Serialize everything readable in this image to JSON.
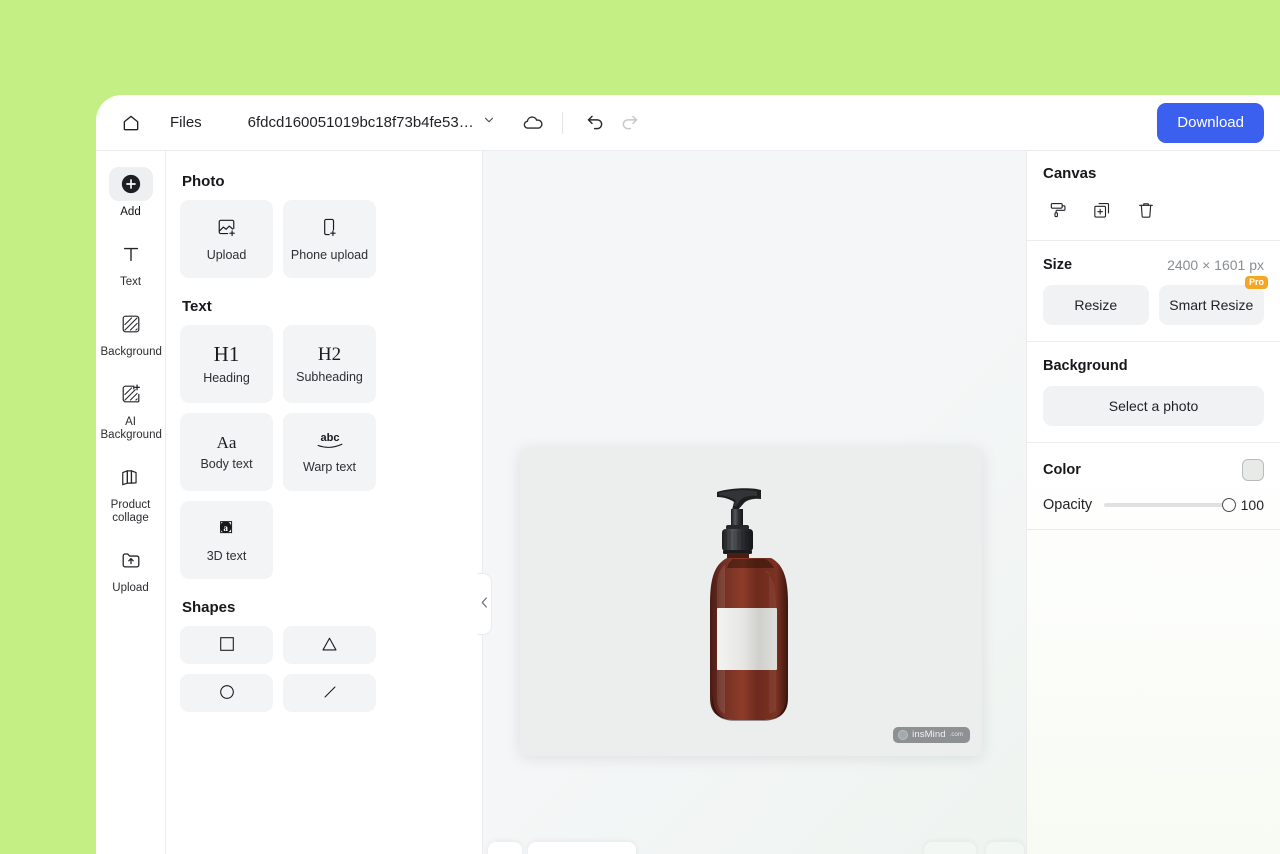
{
  "header": {
    "home_icon": "home-icon",
    "files_label": "Files",
    "document_name": "6fdcd160051019bc18f73b4fe53ae1...",
    "chevron_icon": "chevron-down-icon",
    "cloud_icon": "cloud-save-icon",
    "undo_icon": "undo-icon",
    "redo_icon": "redo-icon",
    "download_label": "Download"
  },
  "rail": {
    "items": [
      {
        "label": "Add",
        "icon": "plus-circle-icon",
        "active": true
      },
      {
        "label": "Text",
        "icon": "text-T-icon",
        "active": false
      },
      {
        "label": "Background",
        "icon": "hatch-square-icon",
        "active": false
      },
      {
        "label": "AI Background",
        "icon": "hatch-sparkle-icon",
        "active": false
      },
      {
        "label": "Product collage",
        "icon": "collage-icon",
        "active": false
      },
      {
        "label": "Upload",
        "icon": "folder-upload-icon",
        "active": false
      }
    ]
  },
  "panel": {
    "photo": {
      "title": "Photo",
      "items": [
        {
          "label": "Upload",
          "icon": "image-upload-icon"
        },
        {
          "label": "Phone upload",
          "icon": "phone-upload-icon"
        }
      ]
    },
    "text": {
      "title": "Text",
      "items": [
        {
          "label": "Heading",
          "glyph": "H1",
          "icon": "heading-icon"
        },
        {
          "label": "Subheading",
          "glyph": "H2",
          "icon": "subheading-icon"
        },
        {
          "label": "Body text",
          "glyph": "Aa",
          "icon": "body-text-icon"
        },
        {
          "label": "Warp text",
          "glyph": "abc",
          "icon": "warp-text-icon"
        },
        {
          "label": "3D text",
          "glyph": "a",
          "icon": "3d-text-icon"
        }
      ]
    },
    "shapes": {
      "title": "Shapes",
      "items": [
        {
          "label": "",
          "icon": "square-shape-icon"
        },
        {
          "label": "",
          "icon": "triangle-shape-icon"
        },
        {
          "label": "",
          "icon": "circle-shape-icon"
        },
        {
          "label": "",
          "icon": "line-shape-icon"
        }
      ]
    },
    "collapse_icon": "chevron-left-icon"
  },
  "canvas": {
    "watermark_text": "insMind",
    "watermark_tld": ".com"
  },
  "right": {
    "title": "Canvas",
    "tools": [
      {
        "icon": "paint-roller-icon"
      },
      {
        "icon": "duplicate-icon"
      },
      {
        "icon": "trash-icon"
      }
    ],
    "size_label": "Size",
    "size_value": "2400 × 1601 px",
    "resize_label": "Resize",
    "smart_resize_label": "Smart Resize",
    "pro_badge": "Pro",
    "background_label": "Background",
    "select_photo_label": "Select a photo",
    "color_label": "Color",
    "color_value": "#e8eae7",
    "opacity_label": "Opacity",
    "opacity_value": "100"
  },
  "theme": {
    "page_background": "#c3ef85",
    "accent": "#3b60f0",
    "pro_badge_color": "#f5a623"
  }
}
